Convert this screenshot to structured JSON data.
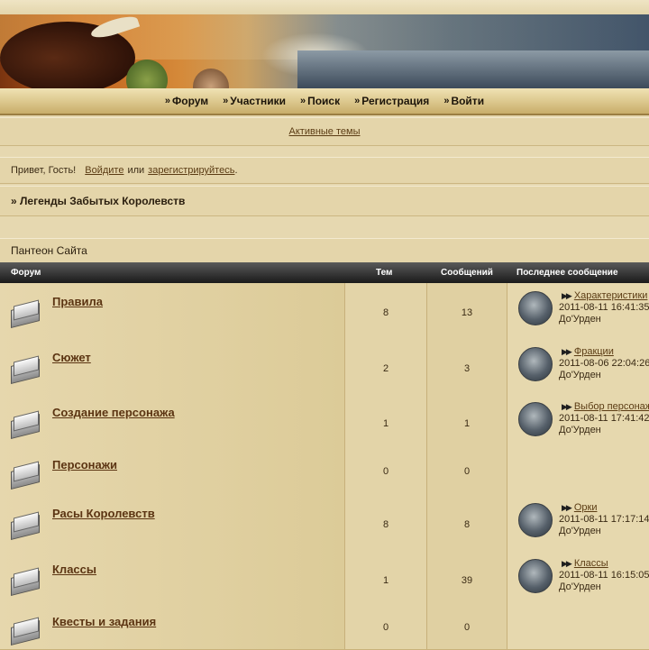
{
  "nav": [
    {
      "label": "Форум",
      "icon": "double-chevron-icon"
    },
    {
      "label": "Участники",
      "icon": "double-chevron-icon"
    },
    {
      "label": "Поиск",
      "icon": "double-chevron-icon"
    },
    {
      "label": "Регистрация",
      "icon": "double-chevron-icon"
    },
    {
      "label": "Войти",
      "icon": "double-chevron-icon"
    }
  ],
  "active_topics": "Активные темы",
  "greeting": {
    "hello": "Привет, Гость!",
    "login": "Войдите",
    "or": "или",
    "register": "зарегистрируйтесь",
    "end": "."
  },
  "breadcrumb": "» Легенды Забытых Королевств",
  "category": "Пантеон Сайта",
  "table_head": {
    "forum": "Форум",
    "topics": "Тем",
    "posts": "Сообщений",
    "last": "Последнее сообщение"
  },
  "forums": [
    {
      "name": "Правила",
      "topics": "8",
      "posts": "13",
      "last": {
        "title": "Характеристики",
        "date": "2011-08-11 16:41:35",
        "user": "До'Урден"
      }
    },
    {
      "name": "Сюжет",
      "topics": "2",
      "posts": "3",
      "last": {
        "title": "Фракции",
        "date": "2011-08-06 22:04:26",
        "user": "До'Урден"
      }
    },
    {
      "name": "Создание персонажа",
      "topics": "1",
      "posts": "1",
      "last": {
        "title": "Выбор персонажа",
        "date": "2011-08-11 17:41:42",
        "user": "До'Урден"
      }
    },
    {
      "name": "Персонажи",
      "topics": "0",
      "posts": "0",
      "last": null
    },
    {
      "name": "Расы Королевств",
      "topics": "8",
      "posts": "8",
      "last": {
        "title": "Орки",
        "date": "2011-08-11 17:17:14",
        "user": "До'Урден"
      }
    },
    {
      "name": "Классы",
      "topics": "1",
      "posts": "39",
      "last": {
        "title": "Классы",
        "date": "2011-08-11 16:15:05",
        "user": "До'Урден"
      }
    },
    {
      "name": "Квесты и задания",
      "topics": "0",
      "posts": "0",
      "last": null
    }
  ]
}
